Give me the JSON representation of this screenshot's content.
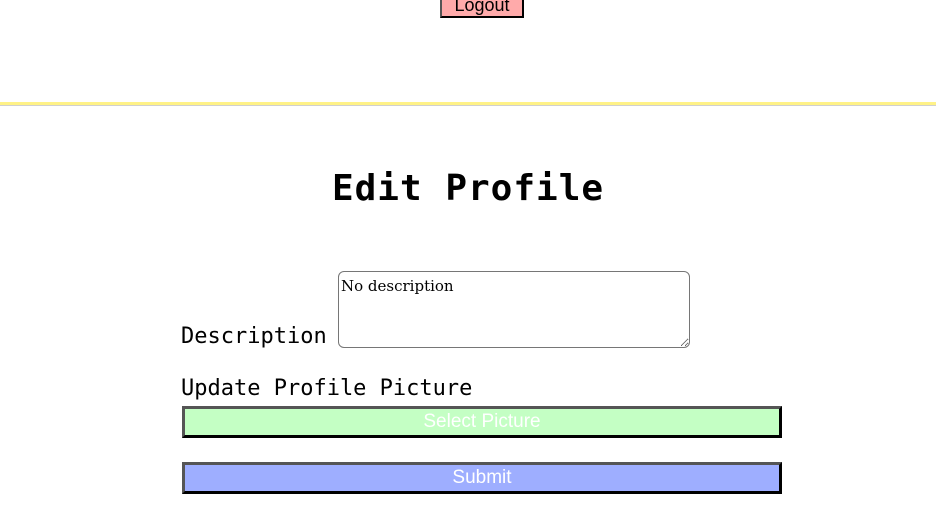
{
  "header": {
    "logout_label": "Logout"
  },
  "main": {
    "title": "Edit Profile",
    "description_label": "Description",
    "description_value": "No description",
    "picture_label": "Update Profile Picture",
    "select_picture_label": "Select Picture",
    "submit_label": "Submit"
  },
  "colors": {
    "logout_bg": "#ffaaaa",
    "divider": "#fff287",
    "select_bg": "#c4ffc4",
    "submit_bg": "#9eaeff"
  }
}
